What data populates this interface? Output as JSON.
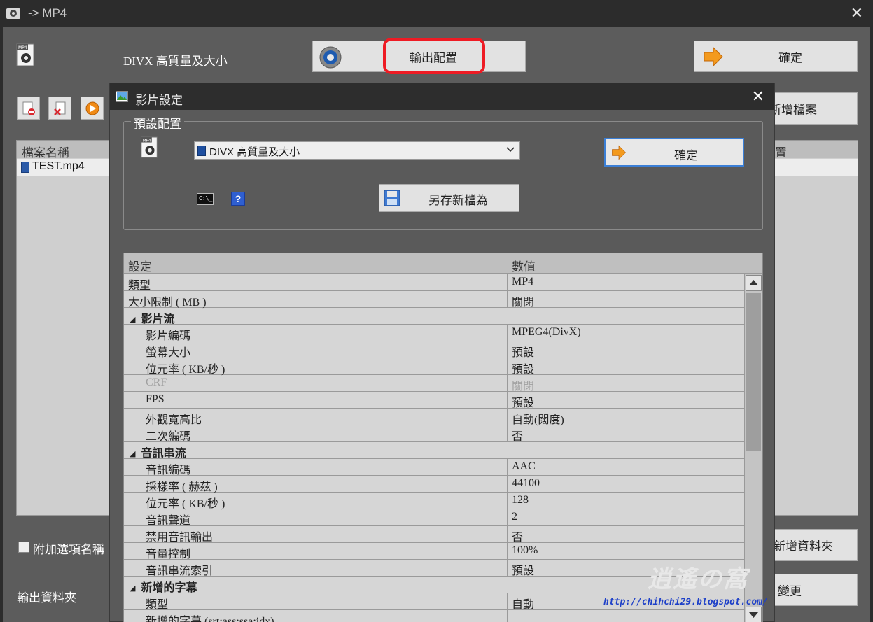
{
  "window": {
    "title": "-> MP4",
    "close_glyph": "✕"
  },
  "main": {
    "preset_name": "DIVX 高質量及大小",
    "output_config_label": "輸出配置",
    "confirm_label": "確定",
    "add_file_label": "新增檔案",
    "file_list": {
      "header_name": "檔案名稱",
      "header_right": "置",
      "files": [
        "TEST.mp4"
      ]
    },
    "append_option_label": "附加選項名稱",
    "add_folder_label": "新增資料夾",
    "output_folder_label": "輸出資料夾",
    "change_label": "變更",
    "toolbar_icons": [
      "remove-icon",
      "clear-list-icon",
      "play-icon"
    ]
  },
  "watermark": {
    "text": "逍遙の窩",
    "url": "http://chihchi29.blogspot.com/"
  },
  "dialog": {
    "title": "影片設定",
    "close_glyph": "✕",
    "group_label": "預設配置",
    "preset_value": "DIVX 高質量及大小",
    "confirm_label": "確定",
    "save_as_label": "另存新檔為",
    "cmd_icon_text": "C:\\_",
    "help_icon_text": "?",
    "grid": {
      "col_setting": "設定",
      "col_value": "數值",
      "rows": [
        {
          "type": "prop",
          "key": "類型",
          "value": "MP4"
        },
        {
          "type": "prop",
          "key": "大小限制 ( MB )",
          "value": "關閉"
        },
        {
          "type": "section",
          "key": "影片流"
        },
        {
          "type": "prop",
          "indent": true,
          "key": "影片編碼",
          "value": "MPEG4(DivX)"
        },
        {
          "type": "prop",
          "indent": true,
          "key": "螢幕大小",
          "value": "預設"
        },
        {
          "type": "prop",
          "indent": true,
          "key": "位元率 ( KB/秒 )",
          "value": "預設"
        },
        {
          "type": "prop",
          "indent": true,
          "disabled": true,
          "key": "CRF",
          "value": "關閉"
        },
        {
          "type": "prop",
          "indent": true,
          "key": "FPS",
          "value": "預設"
        },
        {
          "type": "prop",
          "indent": true,
          "key": "外觀寬高比",
          "value": "自動(闊度)"
        },
        {
          "type": "prop",
          "indent": true,
          "key": "二次編碼",
          "value": "否"
        },
        {
          "type": "section",
          "key": "音訊串流"
        },
        {
          "type": "prop",
          "indent": true,
          "key": "音訊編碼",
          "value": "AAC"
        },
        {
          "type": "prop",
          "indent": true,
          "key": "採樣率 ( 赫茲 )",
          "value": "44100"
        },
        {
          "type": "prop",
          "indent": true,
          "key": "位元率 ( KB/秒 )",
          "value": "128"
        },
        {
          "type": "prop",
          "indent": true,
          "key": "音訊聲道",
          "value": "2"
        },
        {
          "type": "prop",
          "indent": true,
          "key": "禁用音訊輸出",
          "value": "否"
        },
        {
          "type": "prop",
          "indent": true,
          "key": "音量控制",
          "value": "100%"
        },
        {
          "type": "prop",
          "indent": true,
          "key": "音訊串流索引",
          "value": "預設"
        },
        {
          "type": "section",
          "key": "新增的字幕"
        },
        {
          "type": "prop",
          "indent": true,
          "key": "類型",
          "value": "自動"
        },
        {
          "type": "prop",
          "indent": true,
          "key": "新增的字幕 (srt;ass;ssa;idx)",
          "value": ""
        }
      ]
    }
  },
  "colors": {
    "highlight": "#ee1b24",
    "accent_border": "#3b7fd6",
    "titlebar": "#2c2c2c"
  }
}
